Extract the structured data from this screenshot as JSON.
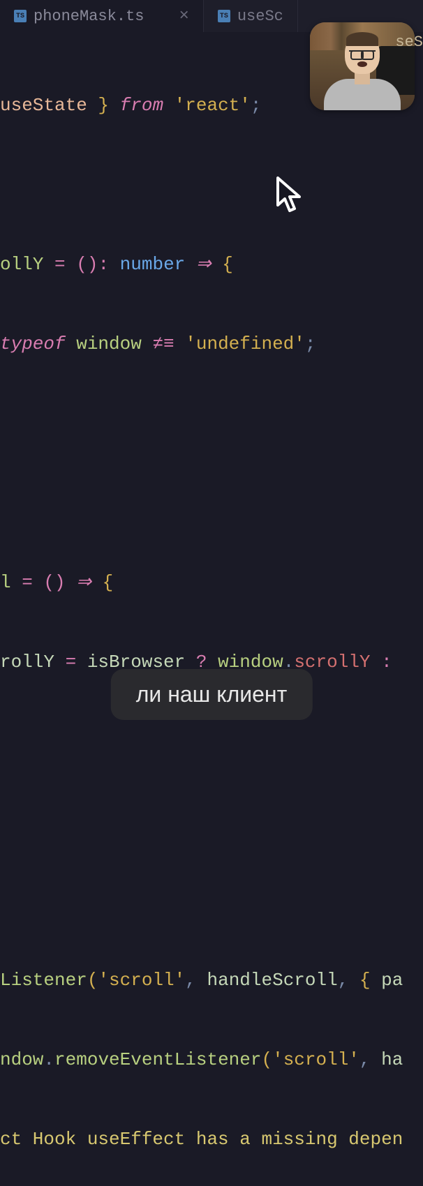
{
  "tabs": {
    "active": {
      "icon": "TS",
      "label": "phoneMask.ts"
    },
    "inactive": {
      "icon": "TS",
      "label": "useSc"
    }
  },
  "code": {
    "l1_use": "useState",
    "l1_brace": " } ",
    "l1_from": "from",
    "l1_str": "'react'",
    "l1_semi": ";",
    "l2_ollY": "ollY",
    "l2_eq": " = ",
    "l2_paren": "()",
    "l2_colon": ":",
    "l2_type": " number ",
    "l2_arrow": "⇒",
    "l2_brace": " {",
    "l3_typeof": " typeof ",
    "l3_window": "window",
    "l3_neq": " ≠≡",
    "l3_str": " 'undefined'",
    "l3_semi": ";",
    "l4_l": "l",
    "l4_eq": " = ",
    "l4_paren": "()",
    "l4_arrow": " ⇒ ",
    "l4_brace": "{",
    "l5_rollY": "rollY",
    "l5_eq": " = ",
    "l5_isB": "isBrowser",
    "l5_q": " ? ",
    "l5_win": "window",
    "l5_dot": ".",
    "l5_scrollY": "scrollY",
    "l5_colon": " :",
    "l6_listener": "Listener",
    "l6_p1": "(",
    "l6_str1": "'scroll'",
    "l6_c1": ", ",
    "l6_hs": "handleScroll",
    "l6_c2": ", ",
    "l6_objopen": "{ ",
    "l6_pa": "pa",
    "l7_ndow": "ndow",
    "l7_dot": ".",
    "l7_remove": "removeEventListener",
    "l7_p1": "(",
    "l7_str": "'scroll'",
    "l7_c1": ", ",
    "l7_ha": "ha",
    "l8_warn": "ct Hook useEffect has a missing depen"
  },
  "overlay": {
    "text": "seS"
  },
  "caption": "ли наш клиент"
}
